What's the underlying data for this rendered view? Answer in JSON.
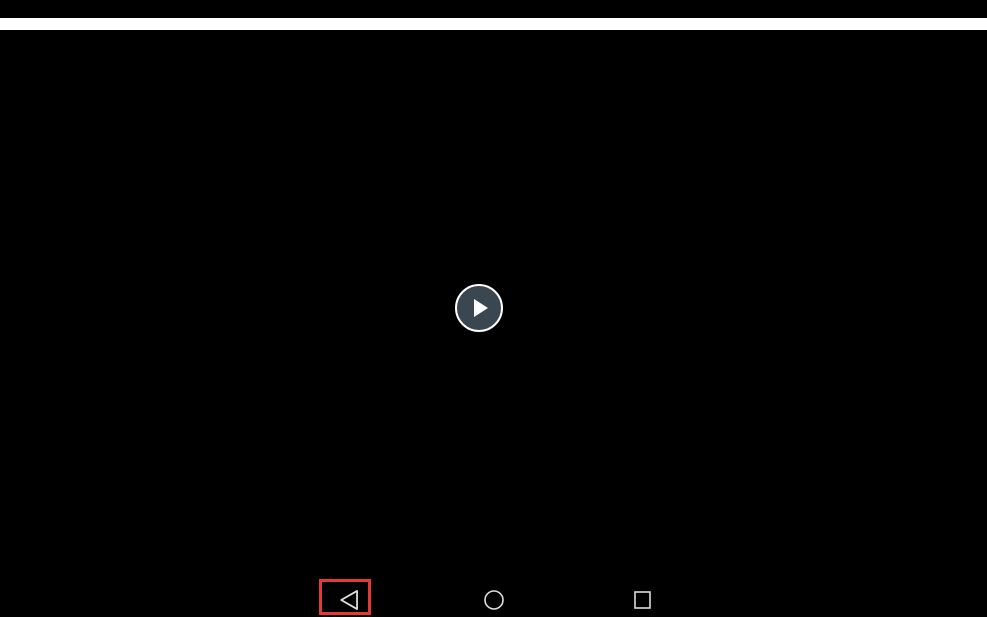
{
  "video": {
    "play_icon": "play-icon"
  },
  "navigation_bar": {
    "back_icon": "back-triangle-icon",
    "home_icon": "home-circle-icon",
    "recents_icon": "recents-square-icon",
    "highlight_color": "#e53935"
  },
  "colors": {
    "background": "#000000",
    "top_bar": "#ffffff",
    "play_button_fill": "#3a4650",
    "nav_icon": "#dddddd"
  }
}
